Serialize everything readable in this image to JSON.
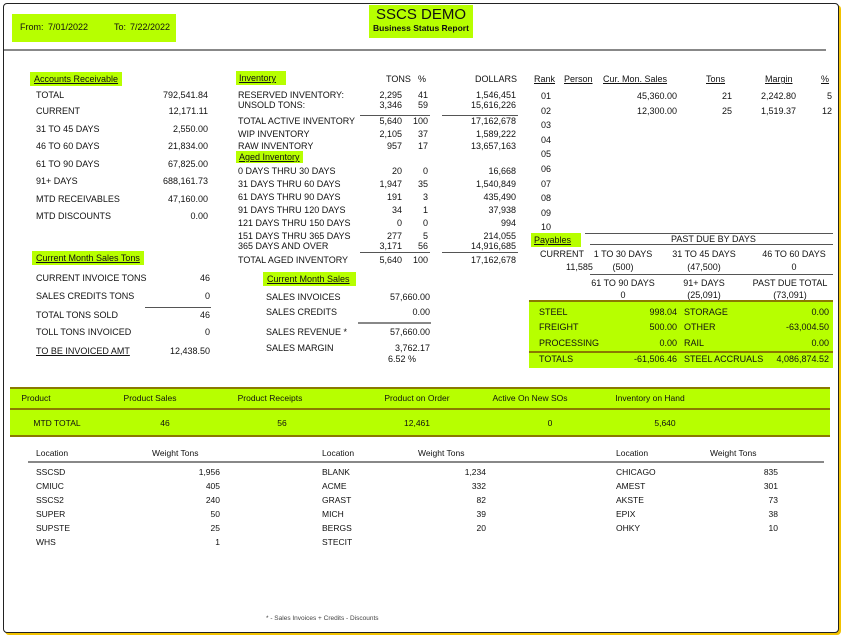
{
  "header": {
    "from_label": "From:",
    "from_date": "7/01/2022",
    "to_label": "To:",
    "to_date": "7/22/2022",
    "title": "SSCS DEMO",
    "subtitle": "Business Status Report"
  },
  "accounts_receivable": {
    "heading": "Accounts Receivable",
    "rows": [
      {
        "label": "TOTAL",
        "value": "792,541.84"
      },
      {
        "label": "CURRENT",
        "value": "12,171.11"
      },
      {
        "label": "31 TO 45 DAYS",
        "value": "2,550.00"
      },
      {
        "label": "46 TO 60 DAYS",
        "value": "21,834.00"
      },
      {
        "label": "61 TO 90 DAYS",
        "value": "67,825.00"
      },
      {
        "label": "91+ DAYS",
        "value": "688,161.73"
      },
      {
        "label": "MTD RECEIVABLES",
        "value": "47,160.00"
      },
      {
        "label": "MTD DISCOUNTS",
        "value": "0.00"
      }
    ]
  },
  "current_month_sales_tons": {
    "heading": "Current Month Sales Tons",
    "rows": [
      {
        "label": "CURRENT INVOICE TONS",
        "value": "46"
      },
      {
        "label": "SALES CREDITS TONS",
        "value": "0"
      },
      {
        "label": "TOTAL TONS SOLD",
        "value": "46"
      },
      {
        "label": "TOLL TONS INVOICED",
        "value": "0"
      },
      {
        "label": "TO BE INVOICED AMT",
        "value": "12,438.50"
      }
    ]
  },
  "inventory": {
    "heading": "Inventory",
    "col_tons": "TONS",
    "col_pct": "%",
    "col_dollars": "DOLLARS",
    "rows": [
      {
        "label": "RESERVED INVENTORY:",
        "tons": "2,295",
        "pct": "41",
        "dollars": "1,546,451"
      },
      {
        "label": "UNSOLD TONS:",
        "tons": "3,346",
        "pct": "59",
        "dollars": "15,616,226"
      },
      {
        "label": "TOTAL ACTIVE INVENTORY",
        "tons": "5,640",
        "pct": "100",
        "dollars": "17,162,678"
      },
      {
        "label": "WIP INVENTORY",
        "tons": "2,105",
        "pct": "37",
        "dollars": "1,589,222"
      },
      {
        "label": "RAW INVENTORY",
        "tons": "957",
        "pct": "17",
        "dollars": "13,657,163"
      }
    ]
  },
  "aged_inventory": {
    "heading": "Aged Inventory",
    "rows": [
      {
        "label": "0 DAYS THRU 30 DAYS",
        "tons": "20",
        "pct": "0",
        "dollars": "16,668"
      },
      {
        "label": "31 DAYS THRU 60 DAYS",
        "tons": "1,947",
        "pct": "35",
        "dollars": "1,540,849"
      },
      {
        "label": "61 DAYS THRU 90 DAYS",
        "tons": "191",
        "pct": "3",
        "dollars": "435,490"
      },
      {
        "label": "91 DAYS THRU 120 DAYS",
        "tons": "34",
        "pct": "1",
        "dollars": "37,938"
      },
      {
        "label": "121 DAYS THRU 150 DAYS",
        "tons": "0",
        "pct": "0",
        "dollars": "994"
      },
      {
        "label": "151 DAYS THRU 365 DAYS",
        "tons": "277",
        "pct": "5",
        "dollars": "214,055"
      },
      {
        "label": "365 DAYS AND OVER",
        "tons": "3,171",
        "pct": "56",
        "dollars": "14,916,685"
      },
      {
        "label": "TOTAL AGED INVENTORY",
        "tons": "5,640",
        "pct": "100",
        "dollars": "17,162,678"
      }
    ]
  },
  "current_month_sales": {
    "heading": "Current Month Sales",
    "rows": [
      {
        "label": "SALES INVOICES",
        "value": "57,660.00"
      },
      {
        "label": "SALES CREDITS",
        "value": "0.00"
      },
      {
        "label": "SALES REVENUE *",
        "value": "57,660.00"
      },
      {
        "label": "SALES MARGIN",
        "value": "3,762.17"
      }
    ],
    "margin_pct": "6.52 %"
  },
  "ranking": {
    "headers": {
      "rank": "Rank",
      "person": "Person",
      "sales": "Cur. Mon. Sales",
      "tons": "Tons",
      "margin": "Margin",
      "pct": "%"
    },
    "rows": [
      {
        "rank": "01",
        "person": "",
        "sales": "45,360.00",
        "tons": "21",
        "margin": "2,242.80",
        "pct": "5"
      },
      {
        "rank": "02",
        "person": "",
        "sales": "12,300.00",
        "tons": "25",
        "margin": "1,519.37",
        "pct": "12"
      },
      {
        "rank": "03",
        "person": "",
        "sales": "",
        "tons": "",
        "margin": "",
        "pct": ""
      },
      {
        "rank": "04",
        "person": "",
        "sales": "",
        "tons": "",
        "margin": "",
        "pct": ""
      },
      {
        "rank": "05",
        "person": "",
        "sales": "",
        "tons": "",
        "margin": "",
        "pct": ""
      },
      {
        "rank": "06",
        "person": "",
        "sales": "",
        "tons": "",
        "margin": "",
        "pct": ""
      },
      {
        "rank": "07",
        "person": "",
        "sales": "",
        "tons": "",
        "margin": "",
        "pct": ""
      },
      {
        "rank": "08",
        "person": "",
        "sales": "",
        "tons": "",
        "margin": "",
        "pct": ""
      },
      {
        "rank": "09",
        "person": "",
        "sales": "",
        "tons": "",
        "margin": "",
        "pct": ""
      },
      {
        "rank": "10",
        "person": "",
        "sales": "",
        "tons": "",
        "margin": "",
        "pct": ""
      }
    ]
  },
  "payables": {
    "heading": "Payables",
    "past_due_heading": "PAST DUE BY DAYS",
    "current_label": "CURRENT",
    "current_value": "11,585",
    "d1_30_label": "1 TO 30 DAYS",
    "d1_30_value": "(500)",
    "d31_45_label": "31 TO 45 DAYS",
    "d31_45_value": "(47,500)",
    "d46_60_label": "46 TO 60 DAYS",
    "d46_60_value": "0",
    "d61_90_label": "61 TO 90 DAYS",
    "d61_90_value": "0",
    "d91_label": "91+ DAYS",
    "d91_value": "(25,091)",
    "total_label": "PAST DUE TOTAL",
    "total_value": "(73,091)"
  },
  "accruals": {
    "steel_label": "STEEL",
    "steel_value": "998.04",
    "storage_label": "STORAGE",
    "storage_value": "0.00",
    "freight_label": "FREIGHT",
    "freight_value": "500.00",
    "other_label": "OTHER",
    "other_value": "-63,004.50",
    "processing_label": "PROCESSING",
    "processing_value": "0.00",
    "rail_label": "RAIL",
    "rail_value": "0.00",
    "totals_label": "TOTALS",
    "totals_value": "-61,506.46",
    "steel_accruals_label": "STEEL ACCRUALS",
    "steel_accruals_value": "4,086,874.52"
  },
  "product_summary": {
    "headers": [
      "Product",
      "Product Sales",
      "Product Receipts",
      "Product on Order",
      "Active On New SOs",
      "Inventory on Hand"
    ],
    "row": [
      "MTD TOTAL",
      "46",
      "56",
      "12,461",
      "0",
      "5,640"
    ]
  },
  "locations": {
    "col_location": "Location",
    "col_weight": "Weight Tons",
    "groups": [
      [
        {
          "location": "SSCSD",
          "weight": "1,956"
        },
        {
          "location": "CMIUC",
          "weight": "405"
        },
        {
          "location": "SSCS2",
          "weight": "240"
        },
        {
          "location": "SUPER",
          "weight": "50"
        },
        {
          "location": "SUPSTE",
          "weight": "25"
        },
        {
          "location": "WHS",
          "weight": "1"
        }
      ],
      [
        {
          "location": "BLANK",
          "weight": "1,234"
        },
        {
          "location": "ACME",
          "weight": "332"
        },
        {
          "location": "GRAST",
          "weight": "82"
        },
        {
          "location": "MICH",
          "weight": "39"
        },
        {
          "location": "BERGS",
          "weight": "20"
        },
        {
          "location": "STECIT",
          "weight": ""
        }
      ],
      [
        {
          "location": "CHICAGO",
          "weight": "835"
        },
        {
          "location": "AMEST",
          "weight": "301"
        },
        {
          "location": "AKSTE",
          "weight": "73"
        },
        {
          "location": "EPIX",
          "weight": "38"
        },
        {
          "location": "OHKY",
          "weight": "10"
        }
      ]
    ]
  },
  "footnote": "* - Sales Invoices + Credits - Discounts"
}
